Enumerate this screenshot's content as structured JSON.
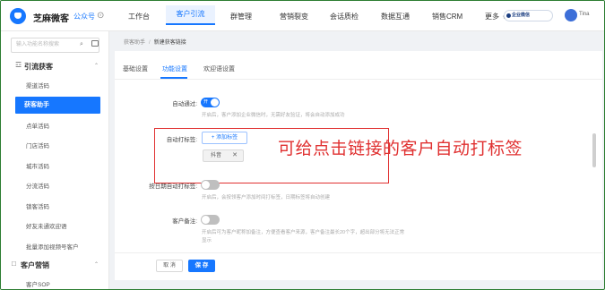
{
  "header": {
    "brand": "芝麻微客",
    "brand_sub": "公众号",
    "brand_icon": "settings-icon",
    "nav": [
      "工作台",
      "客户引流",
      "群管理",
      "营销裂变",
      "会话质检",
      "数据互通",
      "销售CRM",
      "更多"
    ],
    "nav_active_index": 1,
    "more_caret": "v",
    "org": "企业微信",
    "user": "Tina",
    "accent": "#1677ff"
  },
  "sidebar": {
    "search_placeholder": "输入功能名称搜索",
    "search_icon": "search-icon",
    "section1": "引流获客",
    "section1_items": [
      "渠道活码",
      "获客助手",
      "点单活码",
      "门店活码",
      "城市活码",
      "分流活码",
      "锁客活码",
      "好友未通欢迎语",
      "批量添加视频号客户"
    ],
    "active_item": "获客助手",
    "section2": "客户营销",
    "section2_items": [
      "客户SOP"
    ]
  },
  "main": {
    "breadcrumb": [
      "获客助手",
      "新建获客链接"
    ],
    "tabs": [
      "基础设置",
      "功能设置",
      "欢迎语设置"
    ],
    "active_tab": "功能设置",
    "auto_pass": {
      "label": "自动通过:",
      "toggle_text": "开",
      "enabled": true,
      "hint": "开启后，客户添加企业微信时，无需好友验证，将会自动添加成功"
    },
    "auto_tag": {
      "label": "自动打标签:",
      "add_button": "+ 添加标签",
      "tags": [
        "抖音"
      ],
      "annotation": "可给点击链接的客户自动打标签"
    },
    "date_tag": {
      "label": "按日期自动打标签:",
      "enabled": false,
      "hint": "开启后，会按领客户添加时间打标签，日期标签将自动创建"
    },
    "remark": {
      "label": "客户备注:",
      "enabled": false,
      "hint_line1": "开启后可为客户昵称加备注，方便查看客户来源，客户备注最长20个字，超出部分将无法正常",
      "hint_line2": "显示"
    },
    "cancel": "取 消",
    "save": "保 存"
  }
}
